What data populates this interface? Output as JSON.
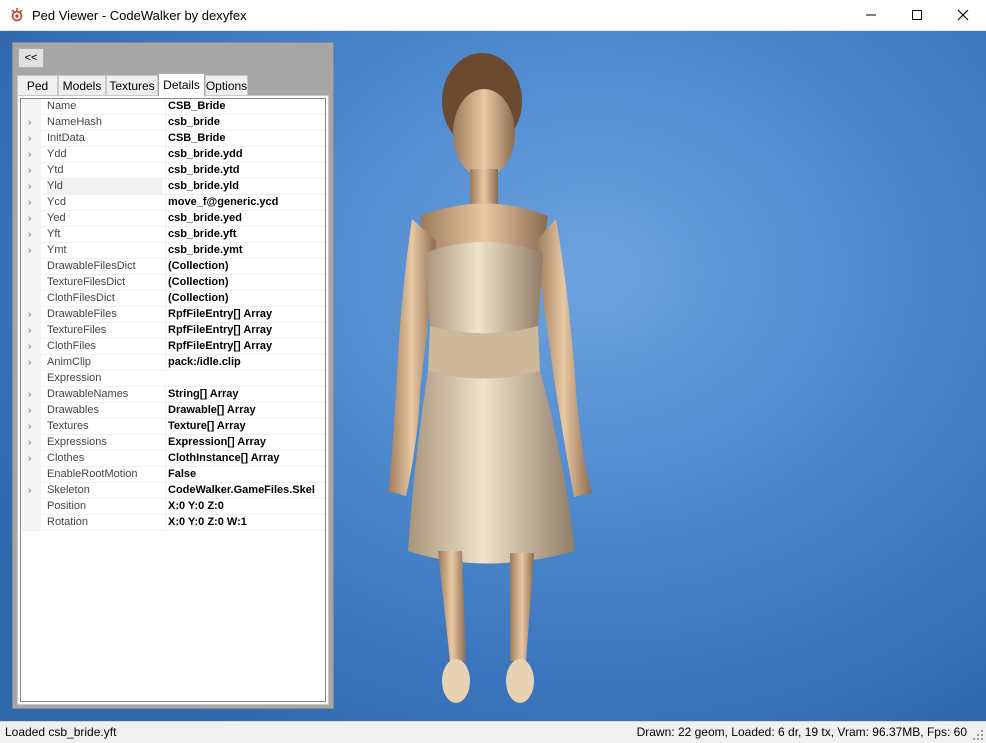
{
  "window": {
    "title": "Ped Viewer - CodeWalker by dexyfex",
    "minimize_icon": "minimize-icon",
    "maximize_icon": "maximize-icon",
    "close_icon": "close-icon"
  },
  "panel": {
    "collapse_label": "<<",
    "tabs": [
      {
        "label": "Ped",
        "active": false
      },
      {
        "label": "Models",
        "active": false
      },
      {
        "label": "Textures",
        "active": false
      },
      {
        "label": "Details",
        "active": true
      },
      {
        "label": "Options",
        "active": false
      }
    ],
    "properties": [
      {
        "name": "Name",
        "value": "CSB_Bride",
        "expandable": false
      },
      {
        "name": "NameHash",
        "value": "csb_bride",
        "expandable": true
      },
      {
        "name": "InitData",
        "value": "CSB_Bride",
        "expandable": true
      },
      {
        "name": "Ydd",
        "value": "csb_bride.ydd",
        "expandable": true
      },
      {
        "name": "Ytd",
        "value": "csb_bride.ytd",
        "expandable": true
      },
      {
        "name": "Yld",
        "value": "csb_bride.yld",
        "expandable": true,
        "selected": true
      },
      {
        "name": "Ycd",
        "value": "move_f@generic.ycd",
        "expandable": true
      },
      {
        "name": "Yed",
        "value": "csb_bride.yed",
        "expandable": true
      },
      {
        "name": "Yft",
        "value": "csb_bride.yft",
        "expandable": true
      },
      {
        "name": "Ymt",
        "value": "csb_bride.ymt",
        "expandable": true
      },
      {
        "name": "DrawableFilesDict",
        "value": "(Collection)",
        "expandable": false
      },
      {
        "name": "TextureFilesDict",
        "value": "(Collection)",
        "expandable": false
      },
      {
        "name": "ClothFilesDict",
        "value": "(Collection)",
        "expandable": false
      },
      {
        "name": "DrawableFiles",
        "value": "RpfFileEntry[] Array",
        "expandable": true
      },
      {
        "name": "TextureFiles",
        "value": "RpfFileEntry[] Array",
        "expandable": true
      },
      {
        "name": "ClothFiles",
        "value": "RpfFileEntry[] Array",
        "expandable": true
      },
      {
        "name": "AnimClip",
        "value": "pack:/idle.clip",
        "expandable": true
      },
      {
        "name": "Expression",
        "value": "",
        "expandable": false
      },
      {
        "name": "DrawableNames",
        "value": "String[] Array",
        "expandable": true
      },
      {
        "name": "Drawables",
        "value": "Drawable[] Array",
        "expandable": true
      },
      {
        "name": "Textures",
        "value": "Texture[] Array",
        "expandable": true
      },
      {
        "name": "Expressions",
        "value": "Expression[] Array",
        "expandable": true
      },
      {
        "name": "Clothes",
        "value": "ClothInstance[] Array",
        "expandable": true
      },
      {
        "name": "EnableRootMotion",
        "value": "False",
        "expandable": false
      },
      {
        "name": "Skeleton",
        "value": "CodeWalker.GameFiles.Skel",
        "expandable": true
      },
      {
        "name": "Position",
        "value": "X:0 Y:0 Z:0",
        "expandable": false
      },
      {
        "name": "Rotation",
        "value": "X:0 Y:0 Z:0 W:1",
        "expandable": false
      }
    ]
  },
  "status": {
    "left": "Loaded csb_bride.yft",
    "right": "Drawn: 22 geom, Loaded: 6 dr, 19 tx, Vram: 96.37MB, Fps: 60"
  },
  "colors": {
    "viewport_bg": "#4f8bcf",
    "panel_bg": "#a6a6a6"
  }
}
